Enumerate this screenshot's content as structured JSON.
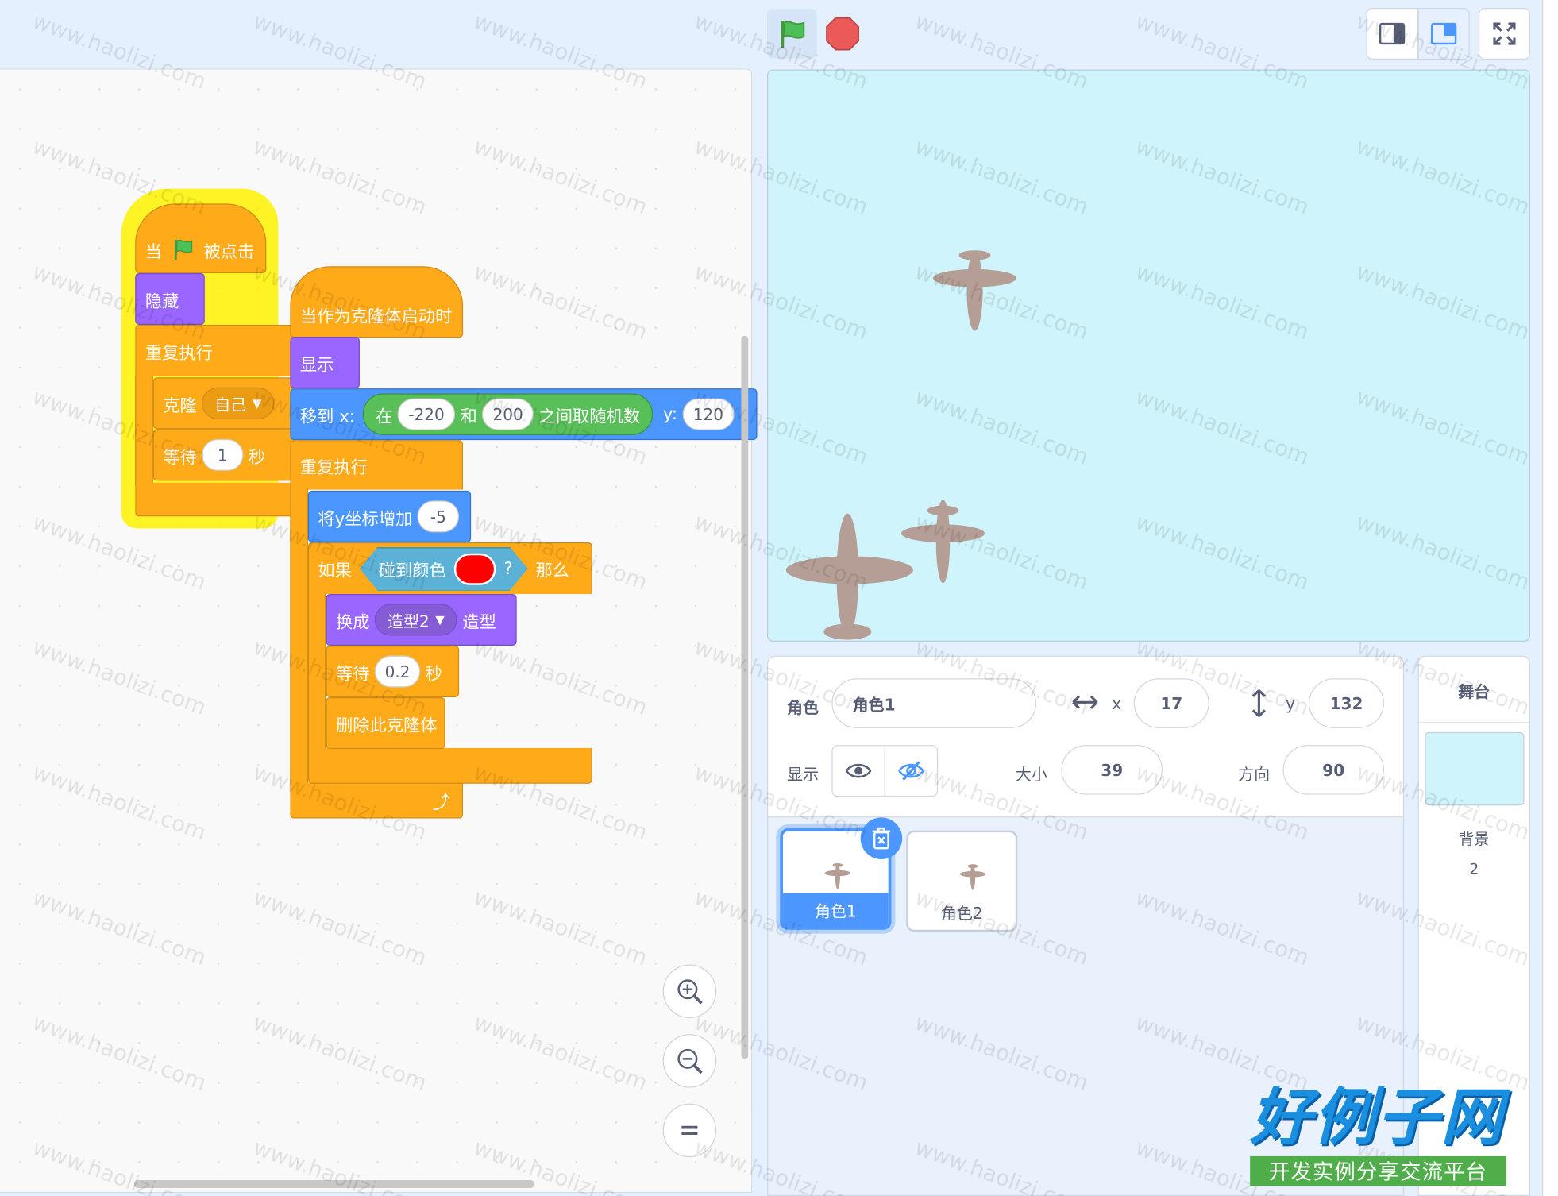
{
  "colors": {
    "events": "#ffab19",
    "looks": "#9966ff",
    "motion": "#4c97ff",
    "operators": "#59c059",
    "sensing": "#5cb1d6",
    "stage_bg": "#cff4fb",
    "selected": "#4c97ff",
    "touch_color": "#ff0000"
  },
  "script1": {
    "hat_prefix": "当",
    "hat_suffix": "被点击",
    "hide": "隐藏",
    "forever": "重复执行",
    "clone_label": "克隆",
    "clone_target": "自己",
    "wait_label": "等待",
    "wait_value": "1",
    "wait_unit": "秒"
  },
  "script2": {
    "hat": "当作为克隆体启动时",
    "show": "显示",
    "goto_label": "移到 x:",
    "random_pre": "在",
    "random_from": "-220",
    "random_and": "和",
    "random_to": "200",
    "random_post": "之间取随机数",
    "y_label": "y:",
    "y_value": "120",
    "forever": "重复执行",
    "change_y": "将y坐标增加",
    "change_y_value": "-5",
    "if_label": "如果",
    "touch_color_label": "碰到颜色",
    "question": "?",
    "then_label": "那么",
    "switch_label": "换成",
    "costume_value": "造型2",
    "costume_suffix": "造型",
    "wait_label": "等待",
    "wait_value": "0.2",
    "wait_unit": "秒",
    "delete_clone": "删除此克隆体"
  },
  "sprite_info": {
    "sprite_label": "角色",
    "sprite_name": "角色1",
    "x_label": "x",
    "x_value": "17",
    "y_label": "y",
    "y_value": "132",
    "show_label": "显示",
    "size_label": "大小",
    "size_value": "39",
    "direction_label": "方向",
    "direction_value": "90"
  },
  "sprites": [
    {
      "name": "角色1",
      "selected": true
    },
    {
      "name": "角色2",
      "selected": false
    }
  ],
  "stage_panel": {
    "title": "舞台",
    "backdrop_label": "背景",
    "backdrop_count": "2"
  },
  "watermark": {
    "text": "www.haolizi.com",
    "brand_title": "好例子网",
    "brand_subtitle": "开发实例分享交流平台"
  },
  "icons": [
    "green-flag-icon",
    "stop-icon",
    "small-stage-icon",
    "normal-stage-icon",
    "fullscreen-icon",
    "zoom-in-icon",
    "zoom-out-icon",
    "zoom-reset-icon",
    "eye-icon",
    "eye-off-icon",
    "x-arrows-icon",
    "y-arrows-icon",
    "trash-icon",
    "airplane-icon"
  ]
}
